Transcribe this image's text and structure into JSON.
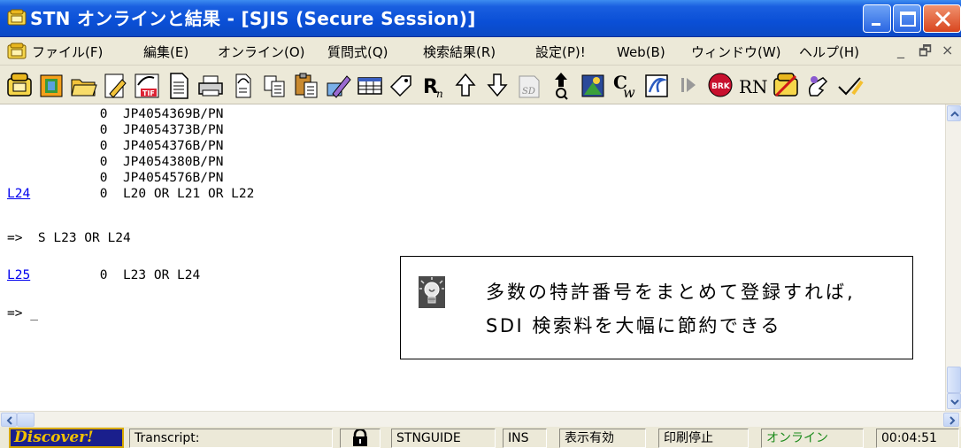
{
  "window": {
    "title": "STN オンラインと結果 - [SJIS (Secure Session)]"
  },
  "menu": {
    "items": [
      "ファイル(F)",
      "編集(E)",
      "オンライン(O)",
      "質問式(Q)",
      "検索結果(R)",
      "設定(P)!",
      "Web(B)",
      "ウィンドウ(W)",
      "ヘルプ(H)"
    ],
    "mdi_minimize": "_",
    "mdi_restore": "🗗",
    "mdi_close": "×"
  },
  "toolbar": {
    "icons": [
      "phone-icon",
      "dial-icon",
      "open-folder-icon",
      "edit-icon",
      "tif-icon",
      "document-icon",
      "print-icon",
      "print-setup-icon",
      "copy-icon",
      "paste-icon",
      "edit-query-icon",
      "table-icon",
      "tag-icon",
      "r-n-icon",
      "up-arrow-icon",
      "down-arrow-icon",
      "spelling-icon",
      "upload-query-icon",
      "image-icon",
      "chemistry-icon",
      "structure-icon",
      "play-icon",
      "brk-icon",
      "rn-icon",
      "disconnect-icon",
      "hand-icon",
      "check-icon"
    ],
    "labels": {
      "rn": "RN",
      "brk": "BRK",
      "r_sub": "n",
      "r": "R"
    }
  },
  "transcript": {
    "lines": [
      {
        "prefix": "",
        "text": "            0  JP4054369B/PN"
      },
      {
        "prefix": "",
        "text": "            0  JP4054373B/PN"
      },
      {
        "prefix": "",
        "text": "            0  JP4054376B/PN"
      },
      {
        "prefix": "",
        "text": "            0  JP4054380B/PN"
      },
      {
        "prefix": "",
        "text": "            0  JP4054576B/PN"
      },
      {
        "prefix": "L24",
        "text": "            0  L20 OR L21 OR L22"
      },
      {
        "prefix": "",
        "text": "=>  S L23 OR L24"
      },
      {
        "prefix": "L25",
        "text": "            0  L23 OR L24"
      },
      {
        "prefix": "",
        "text": "=> _"
      }
    ]
  },
  "note": {
    "line1": "多数の特許番号をまとめて登録すれば,",
    "line2": "SDI 検索料を大幅に節約できる"
  },
  "status": {
    "discover": "Discover!",
    "transcript": "Transcript:",
    "service": "STNGUIDE",
    "mode": "INS",
    "display": "表示有効",
    "print": "印刷停止",
    "connection": "オンライン",
    "connection_color": "#1a8a1a",
    "timer": "00:04:51"
  }
}
